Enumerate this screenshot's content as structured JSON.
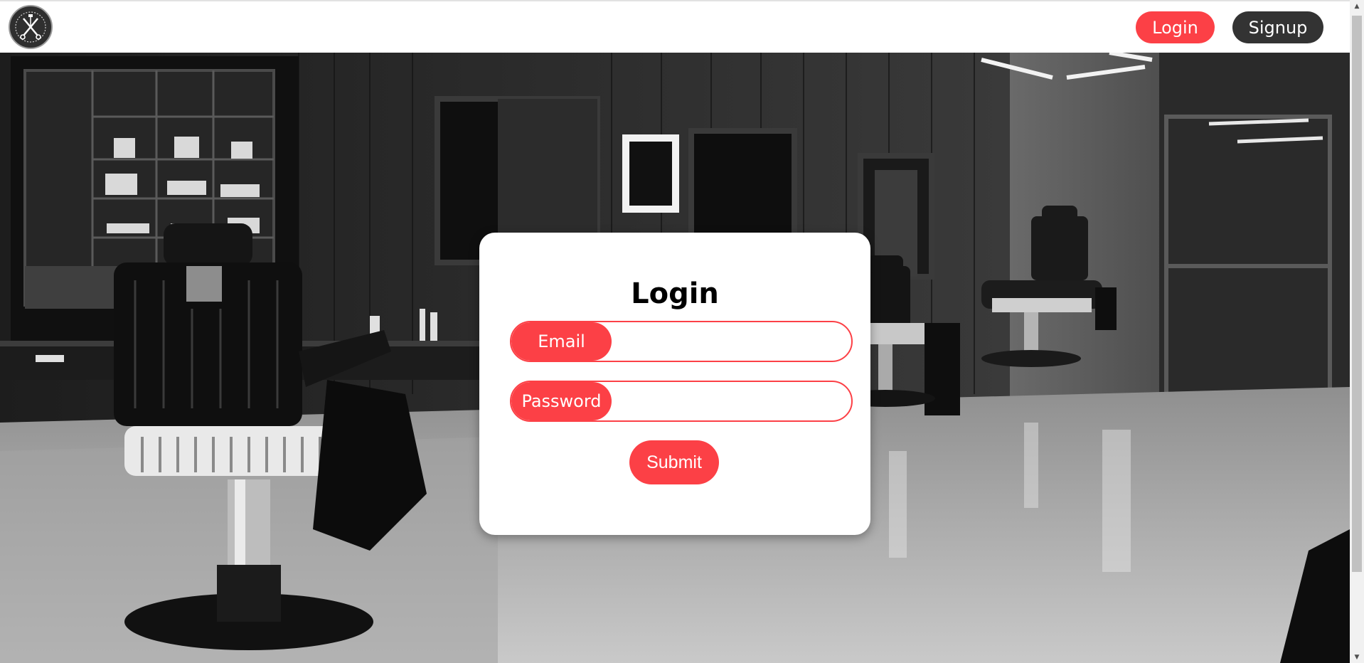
{
  "navbar": {
    "logo_icon": "barber-scissors-razor-logo-icon",
    "login_label": "Login",
    "signup_label": "Signup"
  },
  "hero": {
    "background": "barbershop-interior-grayscale-photo"
  },
  "login_form": {
    "title": "Login",
    "email_label": "Email",
    "email_value": "",
    "password_label": "Password",
    "password_value": "",
    "submit_label": "Submit"
  },
  "colors": {
    "accent": "#fc4046",
    "dark_button": "#333333",
    "card_background": "#ffffff"
  }
}
